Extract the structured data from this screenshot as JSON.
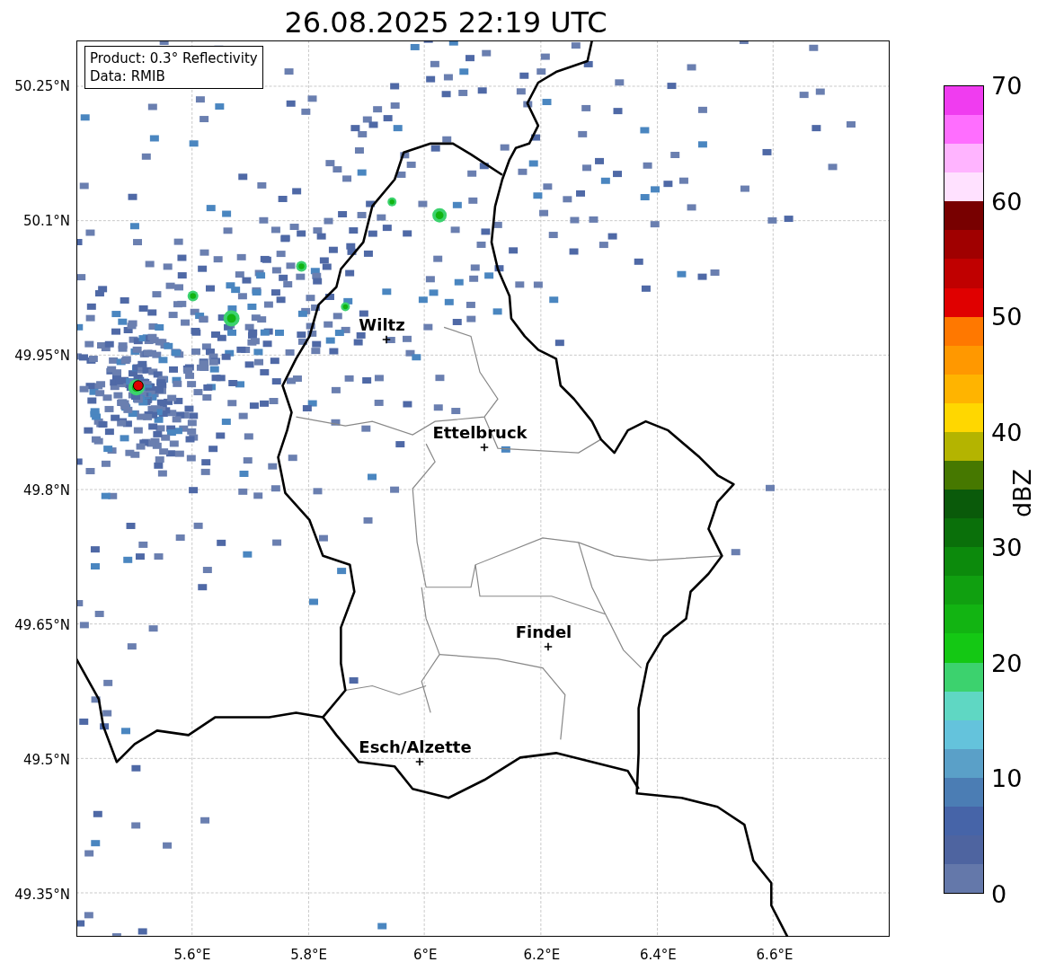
{
  "title": "26.08.2025 22:19 UTC",
  "info_box": {
    "lines": [
      "Product: 0.3° Reflectivity",
      "Data: RMIB"
    ]
  },
  "map": {
    "y_ticks": [
      "50.25°N",
      "50.1°N",
      "49.95°N",
      "49.8°N",
      "49.65°N",
      "49.5°N",
      "49.35°N"
    ],
    "x_ticks": [
      "5.6°E",
      "5.8°E",
      "6°E",
      "6.2°E",
      "6.4°E",
      "6.6°E"
    ],
    "cities": [
      {
        "name": "Wiltz"
      },
      {
        "name": "Ettelbruck"
      },
      {
        "name": "Findel"
      },
      {
        "name": "Esch/Alzette"
      }
    ]
  },
  "colorbar": {
    "label": "dBZ",
    "ticks": [
      "70",
      "60",
      "50",
      "40",
      "30",
      "20",
      "10",
      "0"
    ],
    "segments": [
      {
        "color": "#f03cf0"
      },
      {
        "color": "#ff6eff"
      },
      {
        "color": "#ffb4ff"
      },
      {
        "color": "#ffe1ff"
      },
      {
        "color": "#780000"
      },
      {
        "color": "#a00000"
      },
      {
        "color": "#c00000"
      },
      {
        "color": "#e00000"
      },
      {
        "color": "#ff7800"
      },
      {
        "color": "#ff9800"
      },
      {
        "color": "#ffb400"
      },
      {
        "color": "#ffd700"
      },
      {
        "color": "#b4b400"
      },
      {
        "color": "#467800"
      },
      {
        "color": "#0a5a0a"
      },
      {
        "color": "#0a700a"
      },
      {
        "color": "#0c8a0c"
      },
      {
        "color": "#10a010"
      },
      {
        "color": "#12b412"
      },
      {
        "color": "#14c814"
      },
      {
        "color": "#3cd26e"
      },
      {
        "color": "#5fd7c3"
      },
      {
        "color": "#64c3dc"
      },
      {
        "color": "#5aa0c8"
      },
      {
        "color": "#4b7db4"
      },
      {
        "color": "#4664a8"
      },
      {
        "color": "#4e64a0"
      },
      {
        "color": "#6478aa"
      }
    ]
  }
}
